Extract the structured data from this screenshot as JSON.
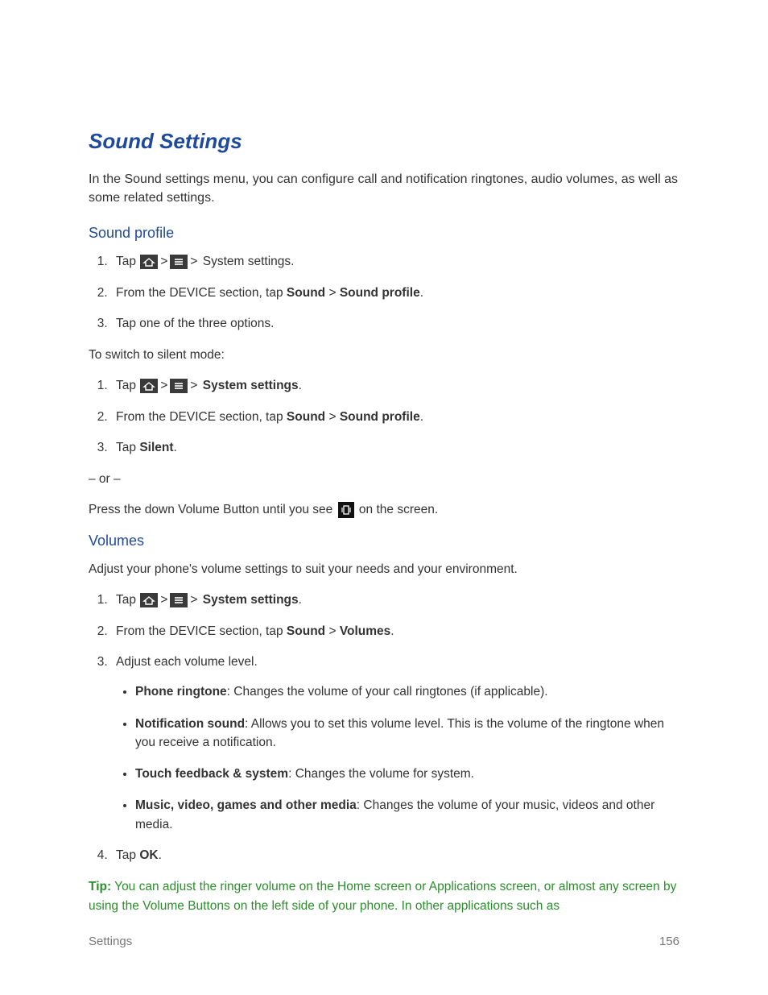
{
  "heading": "Sound Settings",
  "intro": "In the Sound settings menu, you can configure call and notification ringtones, audio volumes, as well as some related settings.",
  "sep": ">",
  "sections": {
    "sound_profile": {
      "heading": "Sound profile",
      "list1": {
        "i1_pre": "Tap ",
        "i1_post": " System settings.",
        "i2_pre": "From the DEVICE section, tap ",
        "i2_b1": "Sound",
        "i2_mid": " > ",
        "i2_b2": "Sound profile",
        "i2_post": ".",
        "i3": "Tap one of the three options."
      },
      "switch_text": "To switch to silent mode:",
      "list2": {
        "i1_pre": "Tap ",
        "i1_post_b": "System settings",
        "i1_post": ".",
        "i2_pre": "From the DEVICE section, tap ",
        "i2_b1": "Sound",
        "i2_mid": " > ",
        "i2_b2": "Sound profile",
        "i2_post": ".",
        "i3_pre": "Tap ",
        "i3_b": "Silent",
        "i3_post": "."
      },
      "or_text": "– or –",
      "press_pre": "Press the down Volume Button until you see ",
      "press_post": " on the screen."
    },
    "volumes": {
      "heading": "Volumes",
      "intro": "Adjust your phone's volume settings to suit your needs and your environment.",
      "list": {
        "i1_pre": "Tap ",
        "i1_post_b": "System settings",
        "i1_post": ".",
        "i2_pre": "From the DEVICE section, tap ",
        "i2_b1": "Sound",
        "i2_mid": " > ",
        "i2_b2": "Volumes",
        "i2_post": ".",
        "i3": "Adjust each volume level.",
        "bullets": {
          "b1_b": "Phone ringtone",
          "b1_t": ": Changes the volume of your call ringtones (if applicable).",
          "b2_b": "Notification sound",
          "b2_t": ": Allows you to set this volume level. This is the volume of the ringtone when you receive a notification.",
          "b3_b": "Touch feedback & system",
          "b3_t": ": Changes the volume for system.",
          "b4_b": "Music, video, games and other media",
          "b4_t": ": Changes the volume of your music, videos and other media."
        },
        "i4_pre": "Tap ",
        "i4_b": "OK",
        "i4_post": "."
      }
    }
  },
  "tip": {
    "label": "Tip:",
    "text": "  You can adjust the ringer volume on the Home screen or Applications screen, or almost any screen by using the Volume Buttons on the left side of your phone. In other applications such as"
  },
  "footer": {
    "section": "Settings",
    "page": "156"
  },
  "icons": {
    "home": "home-icon",
    "menu": "menu-icon",
    "vibrate": "vibrate-icon"
  }
}
